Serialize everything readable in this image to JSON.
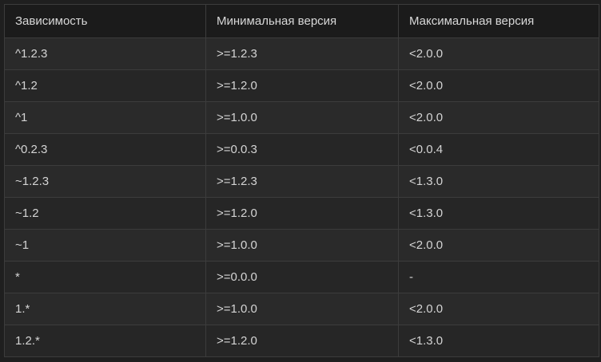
{
  "table": {
    "headers": [
      "Зависимость",
      "Минимальная версия",
      "Максимальная версия"
    ],
    "rows": [
      [
        "^1.2.3",
        ">=1.2.3",
        "<2.0.0"
      ],
      [
        "^1.2",
        ">=1.2.0",
        "<2.0.0"
      ],
      [
        "^1",
        ">=1.0.0",
        "<2.0.0"
      ],
      [
        "^0.2.3",
        ">=0.0.3",
        "<0.0.4"
      ],
      [
        "~1.2.3",
        ">=1.2.3",
        "<1.3.0"
      ],
      [
        "~1.2",
        ">=1.2.0",
        "<1.3.0"
      ],
      [
        "~1",
        ">=1.0.0",
        "<2.0.0"
      ],
      [
        "*",
        ">=0.0.0",
        "-"
      ],
      [
        "1.*",
        ">=1.0.0",
        "<2.0.0"
      ],
      [
        "1.2.*",
        ">=1.2.0",
        "<1.3.0"
      ]
    ]
  }
}
